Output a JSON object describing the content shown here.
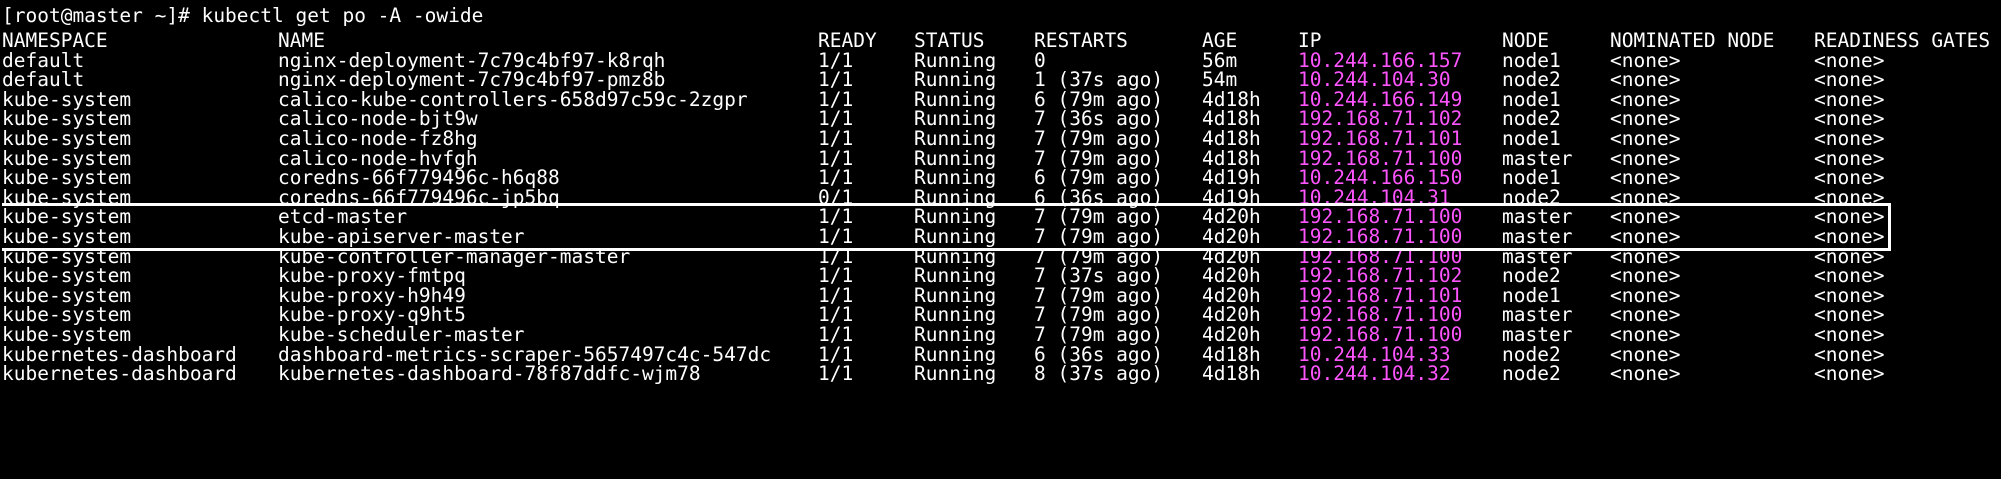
{
  "terminal": {
    "prompt": "[root@master ~]# kubectl get po -A -owide",
    "ip_color": "#ff55ff",
    "headers": {
      "namespace": "NAMESPACE",
      "name": "NAME",
      "ready": "READY",
      "status": "STATUS",
      "restarts": "RESTARTS",
      "age": "AGE",
      "ip": "IP",
      "node": "NODE",
      "nominated": "NOMINATED NODE",
      "gates": "READINESS GATES"
    },
    "rows": [
      {
        "namespace": "default",
        "name": "nginx-deployment-7c79c4bf97-k8rqh",
        "ready": "1/1",
        "status": "Running",
        "restarts": "0",
        "age": "56m",
        "ip": "10.244.166.157",
        "node": "node1",
        "nominated": "<none>",
        "gates": "<none>"
      },
      {
        "namespace": "default",
        "name": "nginx-deployment-7c79c4bf97-pmz8b",
        "ready": "1/1",
        "status": "Running",
        "restarts": "1 (37s ago)",
        "age": "54m",
        "ip": "10.244.104.30",
        "node": "node2",
        "nominated": "<none>",
        "gates": "<none>"
      },
      {
        "namespace": "kube-system",
        "name": "calico-kube-controllers-658d97c59c-2zgpr",
        "ready": "1/1",
        "status": "Running",
        "restarts": "6 (79m ago)",
        "age": "4d18h",
        "ip": "10.244.166.149",
        "node": "node1",
        "nominated": "<none>",
        "gates": "<none>"
      },
      {
        "namespace": "kube-system",
        "name": "calico-node-bjt9w",
        "ready": "1/1",
        "status": "Running",
        "restarts": "7 (36s ago)",
        "age": "4d18h",
        "ip": "192.168.71.102",
        "node": "node2",
        "nominated": "<none>",
        "gates": "<none>"
      },
      {
        "namespace": "kube-system",
        "name": "calico-node-fz8hg",
        "ready": "1/1",
        "status": "Running",
        "restarts": "7 (79m ago)",
        "age": "4d18h",
        "ip": "192.168.71.101",
        "node": "node1",
        "nominated": "<none>",
        "gates": "<none>"
      },
      {
        "namespace": "kube-system",
        "name": "calico-node-hvfgh",
        "ready": "1/1",
        "status": "Running",
        "restarts": "7 (79m ago)",
        "age": "4d18h",
        "ip": "192.168.71.100",
        "node": "master",
        "nominated": "<none>",
        "gates": "<none>"
      },
      {
        "namespace": "kube-system",
        "name": "coredns-66f779496c-h6q88",
        "ready": "1/1",
        "status": "Running",
        "restarts": "6 (79m ago)",
        "age": "4d19h",
        "ip": "10.244.166.150",
        "node": "node1",
        "nominated": "<none>",
        "gates": "<none>"
      },
      {
        "namespace": "kube-system",
        "name": "coredns-66f779496c-jp5bq",
        "ready": "0/1",
        "status": "Running",
        "restarts": "6 (36s ago)",
        "age": "4d19h",
        "ip": "10.244.104.31",
        "node": "node2",
        "nominated": "<none>",
        "gates": "<none>"
      },
      {
        "namespace": "kube-system",
        "name": "etcd-master",
        "ready": "1/1",
        "status": "Running",
        "restarts": "7 (79m ago)",
        "age": "4d20h",
        "ip": "192.168.71.100",
        "node": "master",
        "nominated": "<none>",
        "gates": "<none>"
      },
      {
        "namespace": "kube-system",
        "name": "kube-apiserver-master",
        "ready": "1/1",
        "status": "Running",
        "restarts": "7 (79m ago)",
        "age": "4d20h",
        "ip": "192.168.71.100",
        "node": "master",
        "nominated": "<none>",
        "gates": "<none>"
      },
      {
        "namespace": "kube-system",
        "name": "kube-controller-manager-master",
        "ready": "1/1",
        "status": "Running",
        "restarts": "7 (79m ago)",
        "age": "4d20h",
        "ip": "192.168.71.100",
        "node": "master",
        "nominated": "<none>",
        "gates": "<none>"
      },
      {
        "namespace": "kube-system",
        "name": "kube-proxy-fmtpq",
        "ready": "1/1",
        "status": "Running",
        "restarts": "7 (37s ago)",
        "age": "4d20h",
        "ip": "192.168.71.102",
        "node": "node2",
        "nominated": "<none>",
        "gates": "<none>"
      },
      {
        "namespace": "kube-system",
        "name": "kube-proxy-h9h49",
        "ready": "1/1",
        "status": "Running",
        "restarts": "7 (79m ago)",
        "age": "4d20h",
        "ip": "192.168.71.101",
        "node": "node1",
        "nominated": "<none>",
        "gates": "<none>"
      },
      {
        "namespace": "kube-system",
        "name": "kube-proxy-q9ht5",
        "ready": "1/1",
        "status": "Running",
        "restarts": "7 (79m ago)",
        "age": "4d20h",
        "ip": "192.168.71.100",
        "node": "master",
        "nominated": "<none>",
        "gates": "<none>"
      },
      {
        "namespace": "kube-system",
        "name": "kube-scheduler-master",
        "ready": "1/1",
        "status": "Running",
        "restarts": "7 (79m ago)",
        "age": "4d20h",
        "ip": "192.168.71.100",
        "node": "master",
        "nominated": "<none>",
        "gates": "<none>"
      },
      {
        "namespace": "kubernetes-dashboard",
        "name": "dashboard-metrics-scraper-5657497c4c-547dc",
        "ready": "1/1",
        "status": "Running",
        "restarts": "6 (36s ago)",
        "age": "4d18h",
        "ip": "10.244.104.33",
        "node": "node2",
        "nominated": "<none>",
        "gates": "<none>"
      },
      {
        "namespace": "kubernetes-dashboard",
        "name": "kubernetes-dashboard-78f87ddfc-wjm78",
        "ready": "1/1",
        "status": "Running",
        "restarts": "8 (37s ago)",
        "age": "4d18h",
        "ip": "10.244.104.32",
        "node": "node2",
        "nominated": "<none>",
        "gates": "<none>"
      }
    ]
  }
}
